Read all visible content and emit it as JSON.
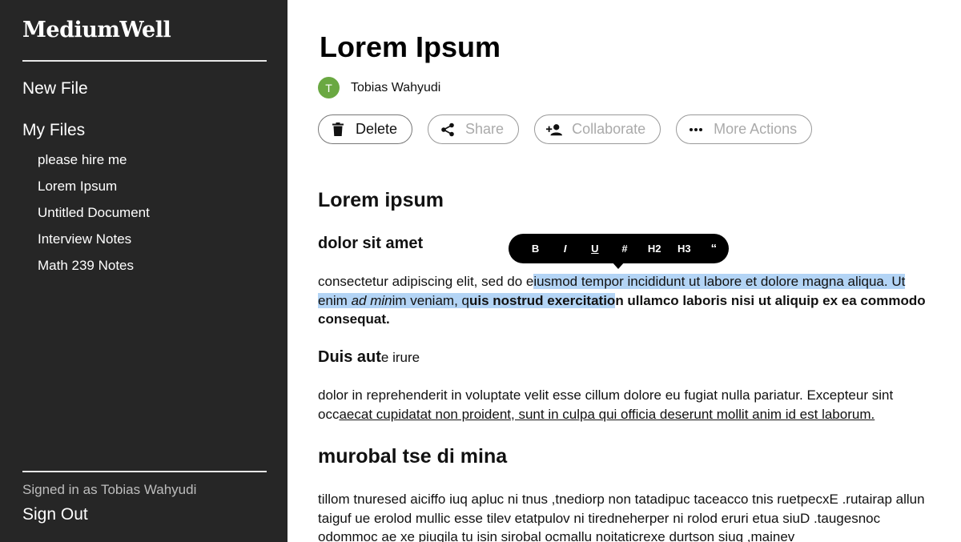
{
  "sidebar": {
    "brand": "MediumWell",
    "new_file": "New File",
    "my_files": "My Files",
    "files": [
      {
        "label": "please hire me"
      },
      {
        "label": "Lorem Ipsum"
      },
      {
        "label": "Untitled Document"
      },
      {
        "label": "Interview Notes"
      },
      {
        "label": "Math 239 Notes"
      }
    ],
    "signed_in": "Signed in as Tobias Wahyudi",
    "sign_out": "Sign Out"
  },
  "document": {
    "title": "Lorem Ipsum",
    "author": {
      "initial": "T",
      "name": "Tobias Wahyudi",
      "avatar_color": "#6aa842"
    },
    "actions": {
      "delete": "Delete",
      "share": "Share",
      "collaborate": "Collaborate",
      "more": "More Actions"
    },
    "body": {
      "h_lorem": "Lorem ipsum",
      "h_dolor": "dolor sit amet",
      "p1": {
        "a": "consectetur adipiscing elit, sed do e",
        "b": "iusmod tempor incididunt ut labore et dolore magna aliqua. Ut enim ",
        "c": "ad min",
        "d": "im veniam, q",
        "e": "uis nostrud exercitatio",
        "f": "n ullamco laboris nisi ut aliquip ex ea commodo consequat."
      },
      "h_duis": {
        "bold": "Duis aut",
        "rest": "e irure"
      },
      "p2": {
        "a": "dolor in reprehenderit in voluptate velit esse cillum dolore eu fugiat nulla pariatur. Excepteur sint occ",
        "b": "aecat cupidatat non proident, sunt in culpa qui officia deserunt mollit anim id est laborum."
      },
      "h_murobal": "murobal tse di mina",
      "p3": "tillom tnuresed aiciffo iuq apluc ni tnus ,tnediorp non tatadipuc taceacco tnis ruetpecxE .rutairap allun taiguf ue erolod mullic esse tilev etatpulov ni tiredneherper ni rolod eruri etua siuD .taugesnoc odommoc ae xe piuqila tu isin sirobal ocmallu noitaticrexe durtson siuq ,mainev"
    }
  },
  "format_toolbar": {
    "bold": "B",
    "italic": "I",
    "underline": "U",
    "heading_hash": "#",
    "h2": "H2",
    "h3": "H3",
    "quote": "“"
  },
  "colors": {
    "sidebar_bg": "#262626",
    "selection": "#b3d4f5",
    "toolbar_bg": "#000000"
  }
}
